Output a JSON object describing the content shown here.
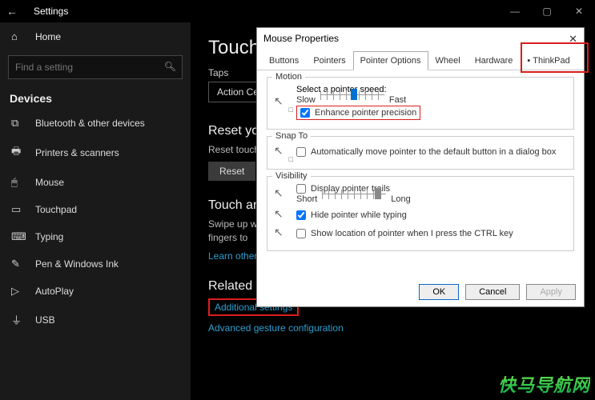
{
  "titlebar": {
    "back": "←",
    "title": "Settings",
    "min": "—",
    "max": "▢",
    "close": "✕"
  },
  "sidebar": {
    "home": "Home",
    "search_placeholder": "Find a setting",
    "section": "Devices",
    "items": [
      {
        "label": "Bluetooth & other devices"
      },
      {
        "label": "Printers & scanners"
      },
      {
        "label": "Mouse"
      },
      {
        "label": "Touchpad"
      },
      {
        "label": "Typing"
      },
      {
        "label": "Pen & Windows Ink"
      },
      {
        "label": "AutoPlay"
      },
      {
        "label": "USB"
      }
    ]
  },
  "main": {
    "heading": "Touchpad",
    "subsection_taps": "Taps",
    "action_btn": "Action Center",
    "reset_h": "Reset your touchpad",
    "reset_body": "Reset touchpad settings and gestures to defaults",
    "reset_btn": "Reset",
    "touch_h": "Touch and gestures",
    "touch_body1": "Swipe up with three fingers to",
    "touch_body2": "fingers to",
    "learn_link": "Learn other gestures",
    "related_h": "Related settings",
    "additional_link": "Additional settings",
    "advanced_link": "Advanced gesture configuration"
  },
  "dialog": {
    "title": "Mouse Properties",
    "tabs": {
      "buttons": "Buttons",
      "pointers": "Pointers",
      "pointer_options": "Pointer Options",
      "wheel": "Wheel",
      "hardware": "Hardware",
      "thinkpad": "ThinkPad"
    },
    "motion": {
      "title": "Motion",
      "speed_label": "Select a pointer speed:",
      "slow": "Slow",
      "fast": "Fast",
      "slider_pos_pct": 48,
      "enhance": "Enhance pointer precision",
      "enhance_checked": true
    },
    "snap": {
      "title": "Snap To",
      "auto": "Automatically move pointer to the default button in a dialog box",
      "checked": false
    },
    "visibility": {
      "title": "Visibility",
      "trails": "Display pointer trails",
      "trails_checked": false,
      "short": "Short",
      "long": "Long",
      "trail_pos_pct": 82,
      "hide": "Hide pointer while typing",
      "hide_checked": true,
      "ctrl": "Show location of pointer when I press the CTRL key",
      "ctrl_checked": false
    },
    "buttons": {
      "ok": "OK",
      "cancel": "Cancel",
      "apply": "Apply"
    }
  },
  "watermark": "快马导航网"
}
